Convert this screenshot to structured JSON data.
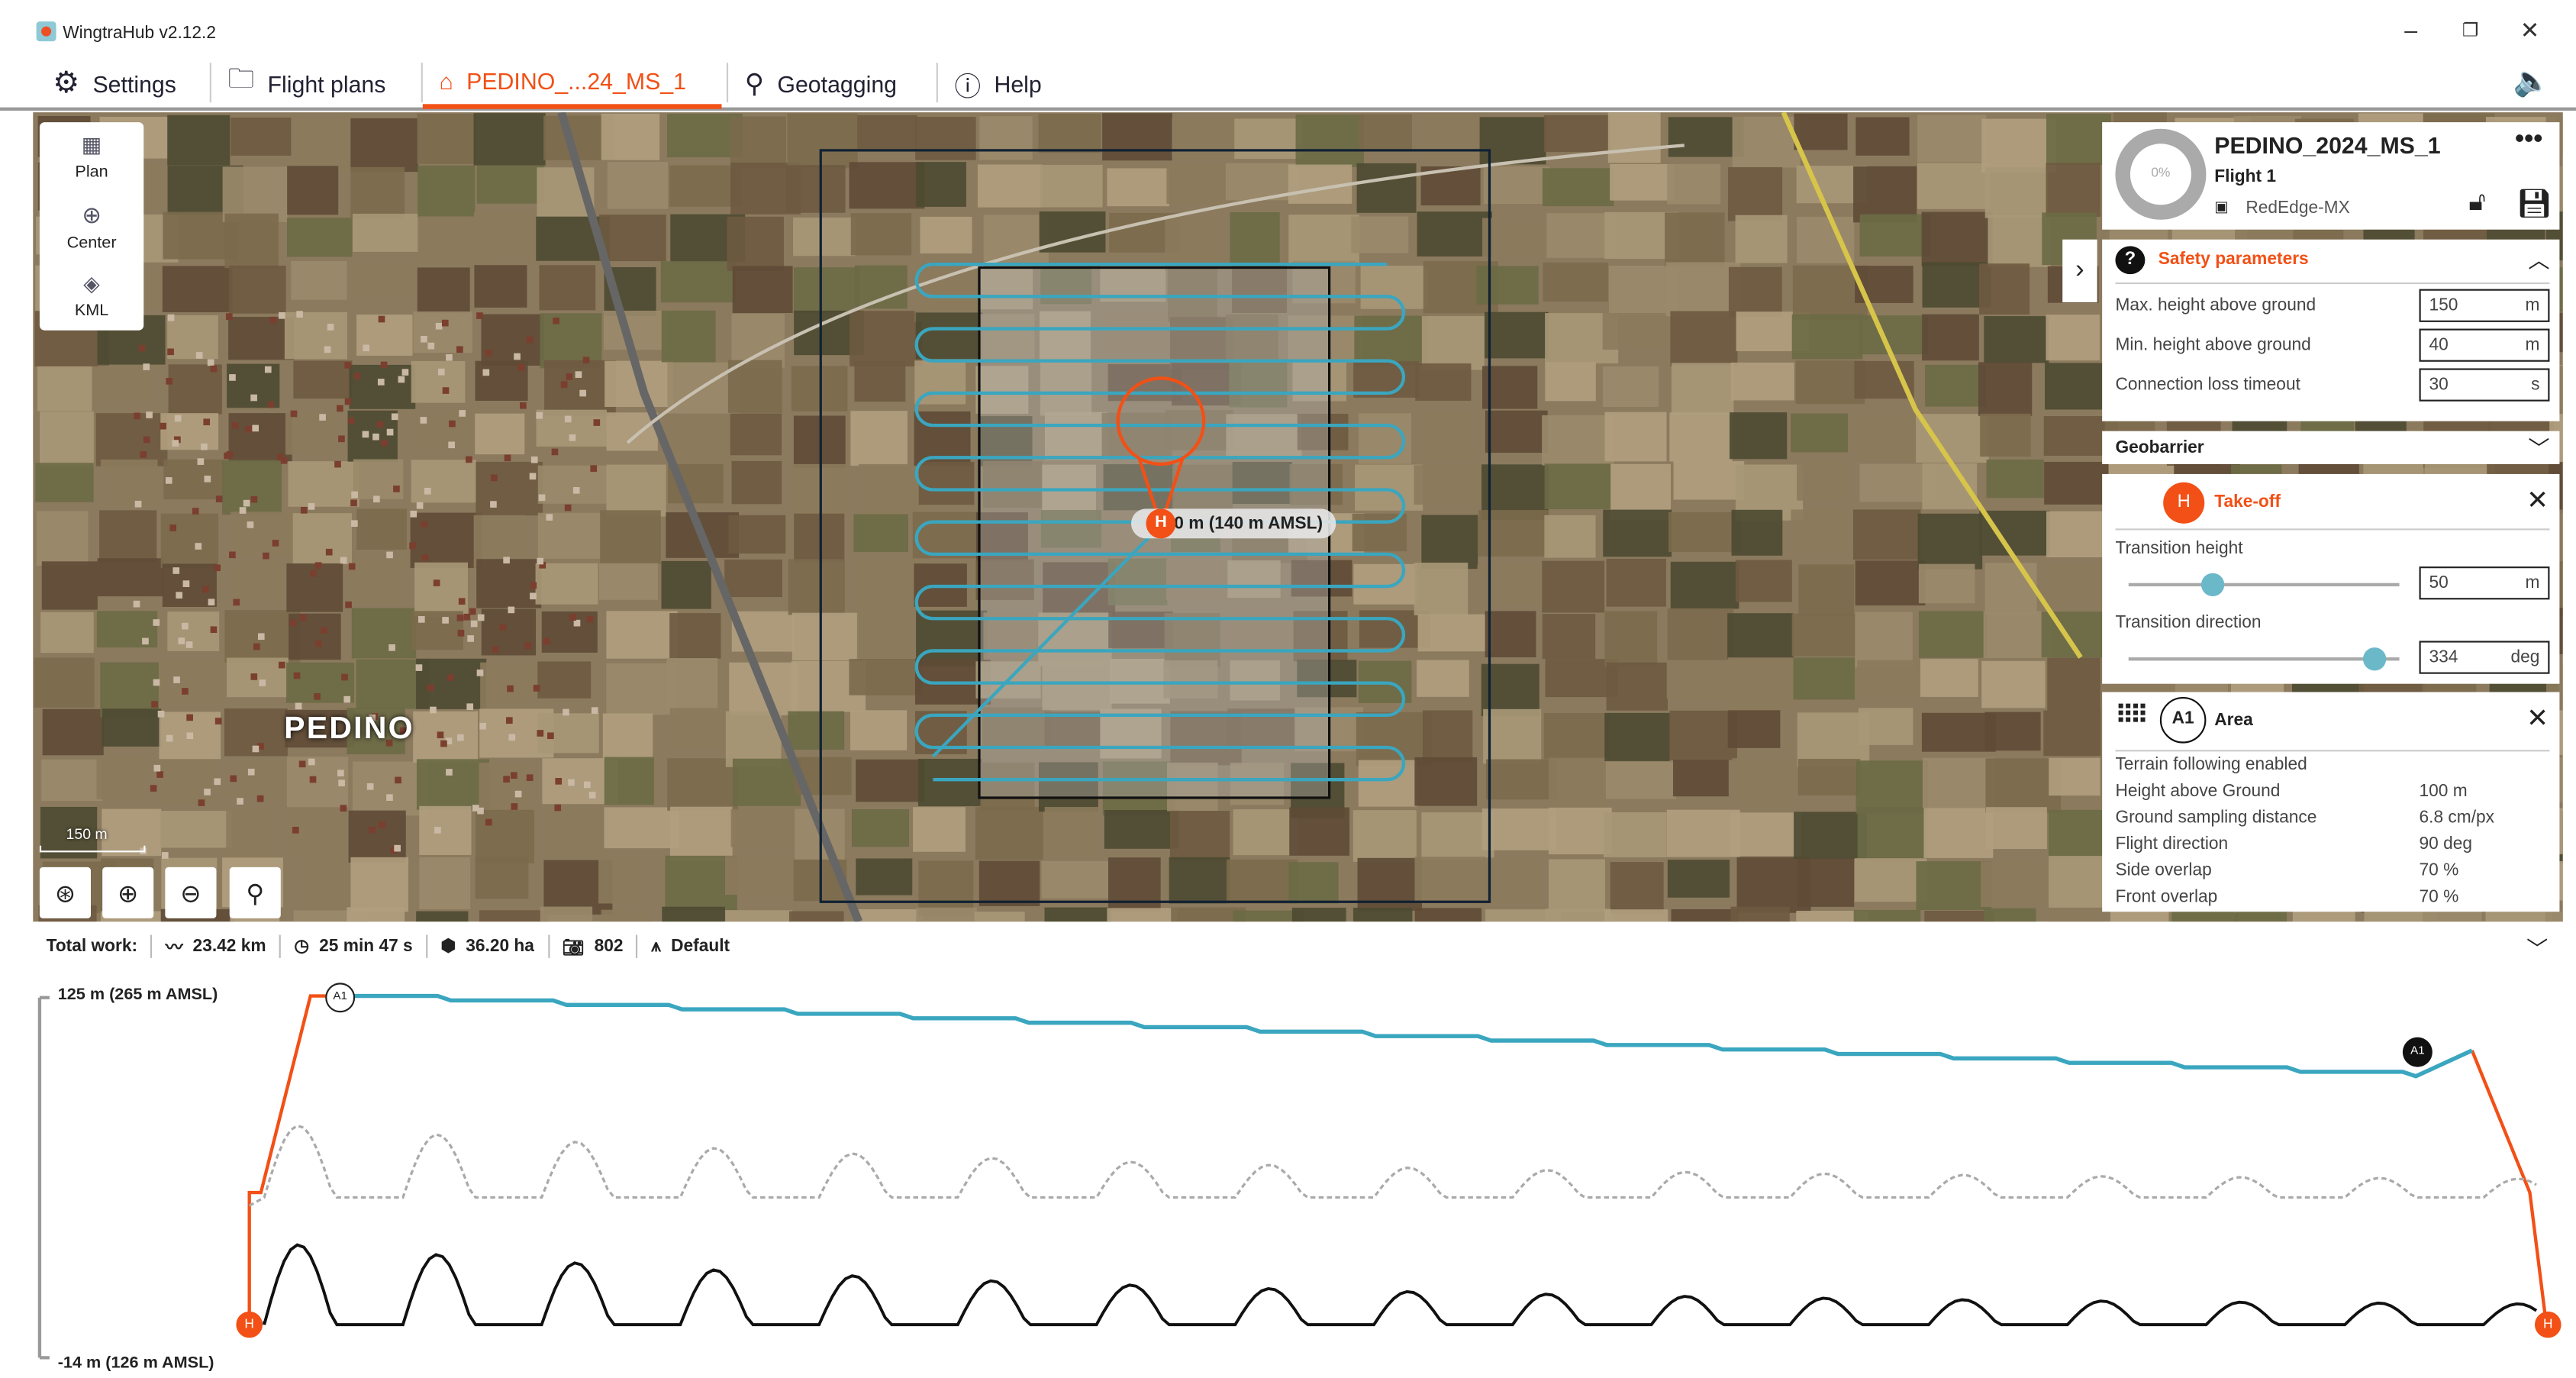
{
  "app": {
    "title": "WingtraHub v2.12.2"
  },
  "tabs": [
    {
      "label": "Settings",
      "icon": "gear-icon"
    },
    {
      "label": "Flight plans",
      "icon": "folder-icon"
    },
    {
      "label": "PEDINO_...24_MS_1",
      "icon": "drone-icon",
      "active": true
    },
    {
      "label": "Geotagging",
      "icon": "pin-icon"
    },
    {
      "label": "Help",
      "icon": "help-icon"
    }
  ],
  "tools": [
    {
      "label": "Plan"
    },
    {
      "label": "Center"
    },
    {
      "label": "KML"
    }
  ],
  "map": {
    "place_label": "PEDINO",
    "scale": "150 m",
    "takeoff_label": "0 m (140 m AMSL)",
    "takeoff_marker": "H"
  },
  "flight": {
    "name": "PEDINO_2024_MS_1",
    "subtitle": "Flight 1",
    "camera": "RedEdge-MX",
    "progress": "0%"
  },
  "safety": {
    "title": "Safety parameters",
    "rows": [
      {
        "label": "Max. height above ground",
        "value": "150",
        "unit": "m"
      },
      {
        "label": "Min. height above ground",
        "value": "40",
        "unit": "m"
      },
      {
        "label": "Connection loss timeout",
        "value": "30",
        "unit": "s"
      }
    ]
  },
  "geobarrier": {
    "title": "Geobarrier"
  },
  "takeoff": {
    "badge": "H",
    "title": "Take-off",
    "height_label": "Transition height",
    "height_value": "50",
    "height_unit": "m",
    "height_fraction": 0.31,
    "dir_label": "Transition direction",
    "dir_value": "334",
    "dir_unit": "deg",
    "dir_fraction": 0.91
  },
  "area": {
    "badge": "A1",
    "title": "Area",
    "terrain": "Terrain following enabled",
    "rows": [
      {
        "label": "Height above Ground",
        "value": "100 m"
      },
      {
        "label": "Ground sampling distance",
        "value": "6.8 cm/px"
      },
      {
        "label": "Flight direction",
        "value": "90 deg"
      },
      {
        "label": "Side overlap",
        "value": "70 %"
      },
      {
        "label": "Front overlap",
        "value": "70 %"
      }
    ]
  },
  "status": {
    "label": "Total work:",
    "distance": "23.42 km",
    "time": "25 min 47 s",
    "area": "36.20 ha",
    "photos": "802",
    "profile": "Default"
  },
  "profile": {
    "top_label": "125 m (265 m AMSL)",
    "bottom_label": "-14 m (126 m AMSL)",
    "start_marker": "A1",
    "end_marker": "A1",
    "home_marker": "H"
  },
  "colors": {
    "accent": "#f25016",
    "path": "#3aa6bf"
  }
}
